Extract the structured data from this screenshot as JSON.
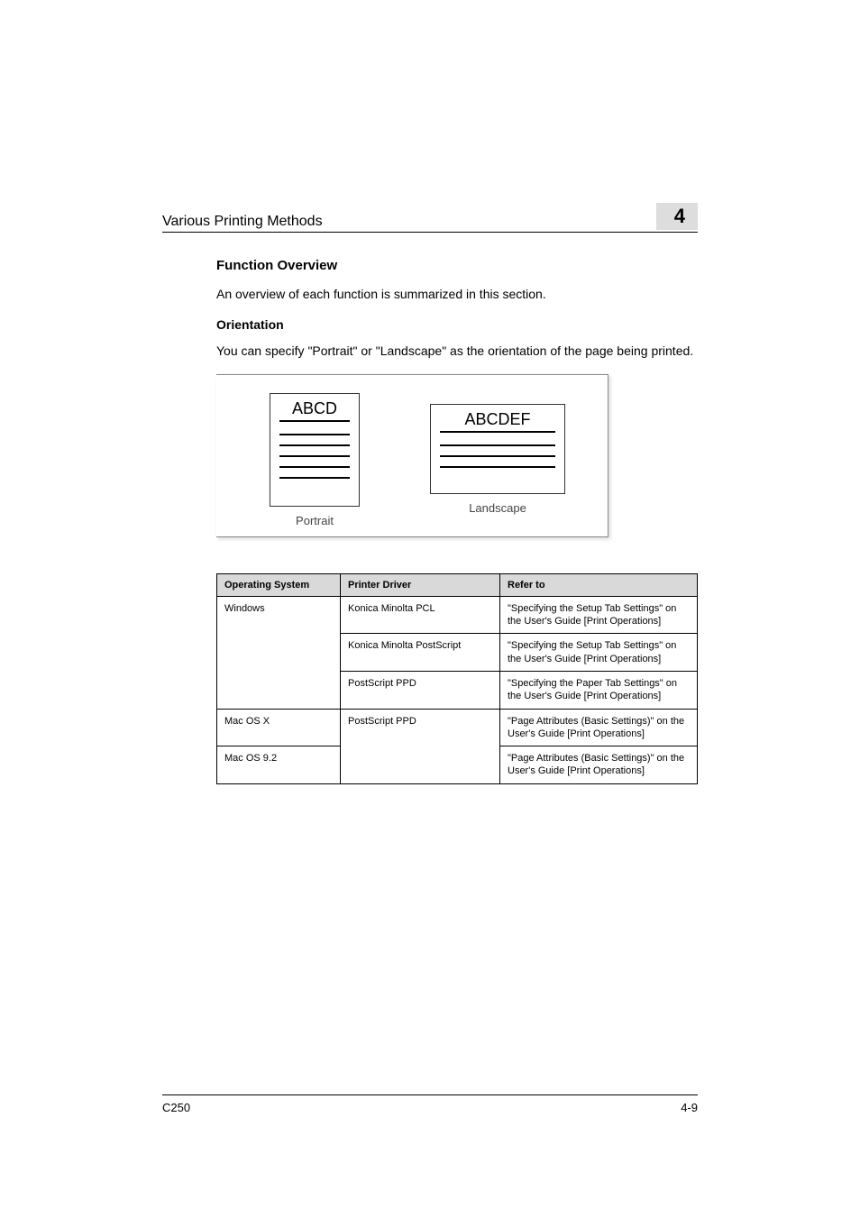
{
  "header": {
    "section_title": "Various Printing Methods",
    "chapter_number": "4"
  },
  "content": {
    "h2": "Function Overview",
    "overview_text": "An overview of each function is summarized in this section.",
    "h3": "Orientation",
    "orientation_text": "You can specify \"Portrait\" or \"Landscape\" as the orientation of the page being printed."
  },
  "diagram": {
    "portrait_title": "ABCD",
    "portrait_label": "Portrait",
    "landscape_title": "ABCDEF",
    "landscape_label": "Landscape"
  },
  "table": {
    "headers": {
      "os": "Operating System",
      "driver": "Printer Driver",
      "refer": "Refer to"
    },
    "rows": [
      {
        "os": "Windows",
        "driver": "Konica Minolta PCL",
        "refer": "\"Specifying the Setup Tab Settings\" on the User's Guide [Print Operations]"
      },
      {
        "os": "",
        "driver": "Konica Minolta PostScript",
        "refer": "\"Specifying the Setup Tab Settings\" on the User's Guide [Print Operations]"
      },
      {
        "os": "",
        "driver": "PostScript PPD",
        "refer": "\"Specifying the Paper Tab Settings\" on the User's Guide [Print Operations]"
      },
      {
        "os": "Mac OS X",
        "driver": "PostScript PPD",
        "refer": "\"Page Attributes (Basic Settings)\" on the User's Guide [Print Operations]"
      },
      {
        "os": "Mac OS 9.2",
        "driver": "",
        "refer": "\"Page Attributes (Basic Settings)\" on the User's Guide [Print Operations]"
      }
    ]
  },
  "footer": {
    "model": "C250",
    "page_num": "4-9"
  }
}
